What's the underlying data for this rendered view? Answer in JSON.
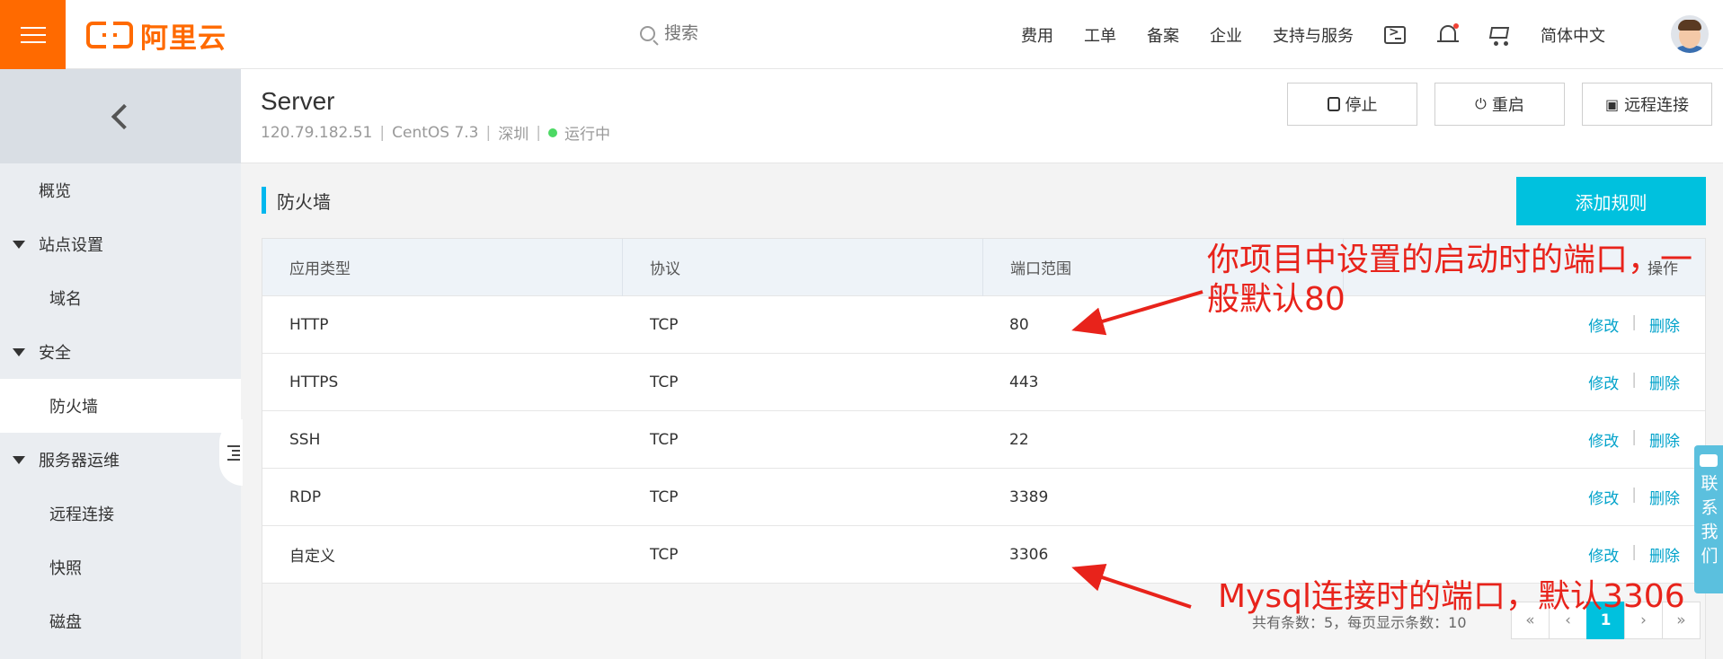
{
  "topbar": {
    "logo_text": "阿里云",
    "search_placeholder": "搜索",
    "nav": [
      "费用",
      "工单",
      "备案",
      "企业",
      "支持与服务"
    ],
    "language": "简体中文",
    "icons": [
      "terminal-icon",
      "bell-icon",
      "cart-icon"
    ],
    "accent_color": "#ff6a00"
  },
  "sidebar": {
    "items": [
      {
        "label": "概览",
        "kind": "top"
      },
      {
        "label": "站点设置",
        "kind": "group"
      },
      {
        "label": "域名",
        "kind": "sub"
      },
      {
        "label": "安全",
        "kind": "group"
      },
      {
        "label": "防火墙",
        "kind": "sub",
        "active": true
      },
      {
        "label": "服务器运维",
        "kind": "group"
      },
      {
        "label": "远程连接",
        "kind": "sub"
      },
      {
        "label": "快照",
        "kind": "sub"
      },
      {
        "label": "磁盘",
        "kind": "sub"
      }
    ]
  },
  "server": {
    "name": "Server",
    "ip": "120.79.182.51",
    "os": "CentOS 7.3",
    "region": "深圳",
    "status": "运行中",
    "status_color": "#4cd964",
    "buttons": {
      "stop": "停止",
      "restart": "重启",
      "remote": "远程连接"
    }
  },
  "firewall": {
    "title": "防火墙",
    "add_rule": "添加规则",
    "columns": [
      "应用类型",
      "协议",
      "端口范围",
      "操作"
    ],
    "rows": [
      {
        "app": "HTTP",
        "protocol": "TCP",
        "port": "80"
      },
      {
        "app": "HTTPS",
        "protocol": "TCP",
        "port": "443"
      },
      {
        "app": "SSH",
        "protocol": "TCP",
        "port": "22"
      },
      {
        "app": "RDP",
        "protocol": "TCP",
        "port": "3389"
      },
      {
        "app": "自定义",
        "protocol": "TCP",
        "port": "3306"
      }
    ],
    "action_edit": "修改",
    "action_delete": "删除",
    "action_sep": "|",
    "pagination": {
      "total_text": "共有条数：5，每页显示条数：10",
      "buttons": [
        "«",
        "‹",
        "1",
        "›",
        "»"
      ],
      "current": "1"
    }
  },
  "annotations": {
    "note_1": "你项目中设置的启动时的端口，一般默认80",
    "note_2": "Mysql连接时的端口，默认3306",
    "color": "#e8231b"
  },
  "contact": {
    "label": "联系我们"
  }
}
